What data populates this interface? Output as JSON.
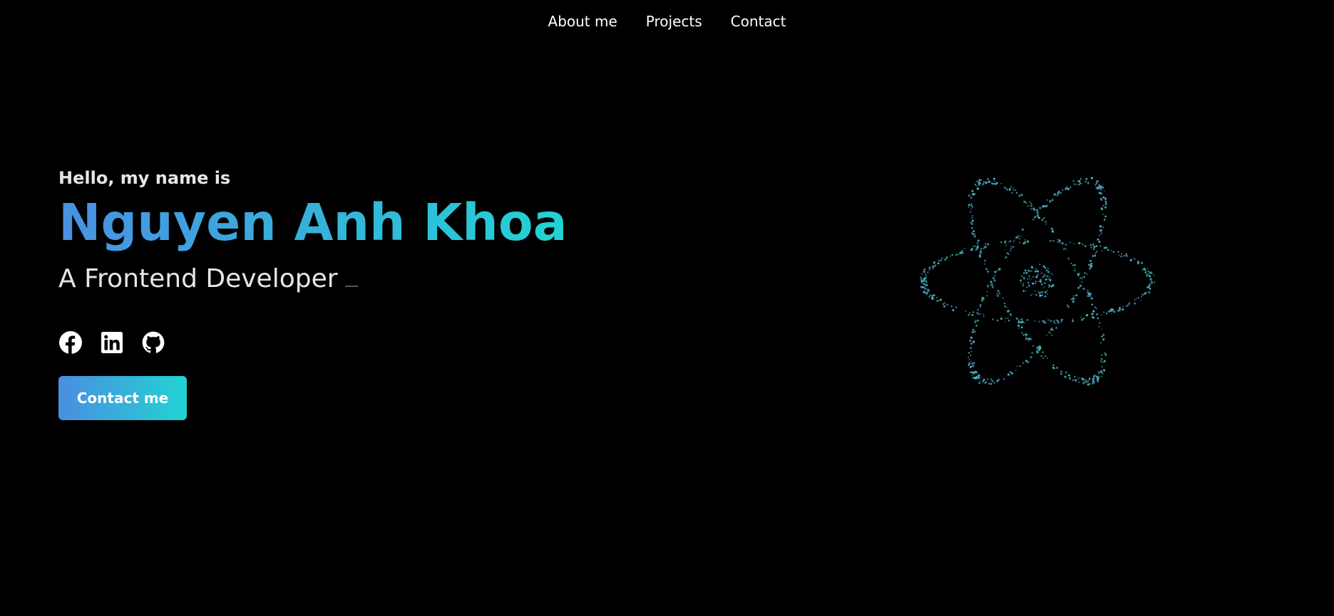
{
  "nav": {
    "items": [
      "About me",
      "Projects",
      "Contact"
    ]
  },
  "hero": {
    "greeting": "Hello, my name is",
    "name": "Nguyen Anh Khoa",
    "role": "A Frontend Developer",
    "cta_label": "Contact me"
  },
  "socials": [
    {
      "icon": "facebook-icon"
    },
    {
      "icon": "linkedin-icon"
    },
    {
      "icon": "github-icon"
    }
  ],
  "colors": {
    "background": "#000000",
    "gradient_start": "#4a90e2",
    "gradient_end": "#22d3d3",
    "atom_particles": "#4fb3c8"
  }
}
